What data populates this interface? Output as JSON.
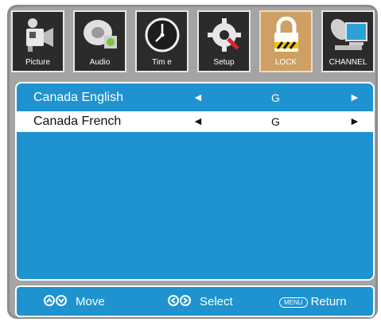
{
  "tabs": [
    {
      "label": "Picture",
      "icon": "camera-icon",
      "active": false
    },
    {
      "label": "Audio",
      "icon": "audio-icon",
      "active": false
    },
    {
      "label": "Tim e",
      "icon": "clock-icon",
      "active": false
    },
    {
      "label": "Setup",
      "icon": "gear-icon",
      "active": false
    },
    {
      "label": "LOCK",
      "icon": "lock-icon",
      "active": true
    },
    {
      "label": "CHANNEL",
      "icon": "satellite-dish-icon",
      "active": false
    }
  ],
  "rows": [
    {
      "name": "Canada English",
      "value": "G",
      "left_arrow": "◄",
      "right_arrow": "►",
      "selected": false
    },
    {
      "name": "Canada French",
      "value": "G",
      "left_arrow": "◄",
      "right_arrow": "►",
      "selected": true
    }
  ],
  "footer": {
    "move_label": "Move",
    "select_label": "Select",
    "menu_key": "MENU",
    "return_label": "Return"
  },
  "colors": {
    "panel_blue": "#1f93cf",
    "active_tab": "#cfa064",
    "tab_bg": "#2b2b2b"
  }
}
